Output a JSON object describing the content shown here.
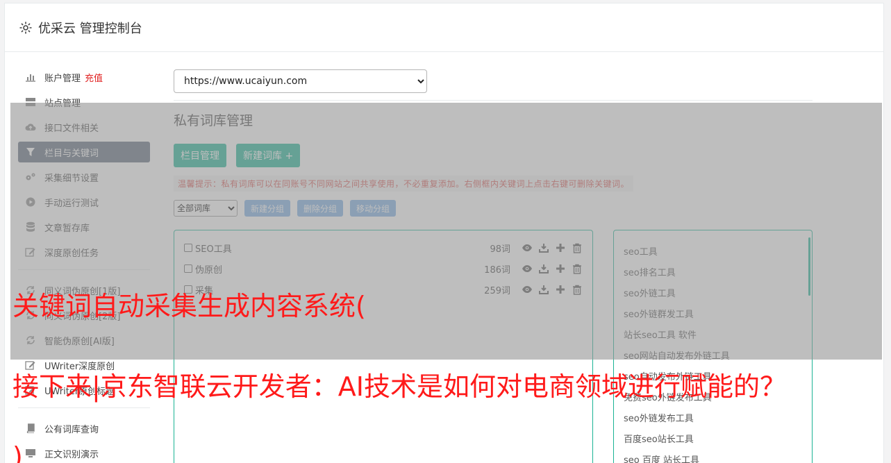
{
  "header": {
    "title": "优采云 管理控制台",
    "icon": "gear-icon"
  },
  "sidebar": {
    "items": [
      {
        "label": "账户管理",
        "extra": "充值",
        "icon": "bar-chart-icon"
      },
      {
        "label": "站点管理",
        "icon": "server-icon"
      },
      {
        "label": "接口文件相关",
        "icon": "cloud-upload-icon"
      },
      {
        "label": "栏目与关键词",
        "icon": "filter-icon",
        "active": true
      },
      {
        "label": "采集细节设置",
        "icon": "gears-icon"
      },
      {
        "label": "手动运行测试",
        "icon": "play-circle-icon"
      },
      {
        "label": "文章暂存库",
        "icon": "database-icon"
      },
      {
        "label": "深度原创任务",
        "icon": "edit-icon"
      },
      {
        "label": "同义词伪原创[1版]",
        "icon": "refresh-icon"
      },
      {
        "label": "同义词伪原创[2版]",
        "icon": "refresh-icon"
      },
      {
        "label": "智能伪原创[AI版]",
        "icon": "refresh-icon"
      },
      {
        "label": "UWriter深度原创",
        "icon": "edit-icon"
      },
      {
        "label": "UWriter原创标题",
        "icon": "edit-icon"
      },
      {
        "label": "公有词库查询",
        "icon": "book-icon"
      },
      {
        "label": "正文识别演示",
        "icon": "monitor-icon"
      }
    ]
  },
  "main": {
    "site_select": "https://www.ucaiyun.com",
    "section_title": "私有词库管理",
    "btn_columns": "栏目管理",
    "btn_new_lib": "新建词库 +",
    "tip": "温馨提示：私有词库可以在同账号不同网站之间共享使用，不必重复添加。右侧框内关键词上点击右键可删除关键词。",
    "filter_select": "全部词库",
    "btn_new_group": "新建分组",
    "btn_delete_group": "删除分组",
    "btn_move_group": "移动分组",
    "libraries": [
      {
        "name": "SEO工具",
        "count": "98词"
      },
      {
        "name": "伪原创",
        "count": "186词"
      },
      {
        "name": "采集",
        "count": "259词"
      }
    ],
    "keywords": [
      "seo工具",
      "seo排名工具",
      "seo外链工具",
      "seo外链群发工具",
      "站长seo工具 软件",
      "seo网站自动发布外链工具",
      "seo自动发布外链工具",
      "免费seo外链发布工具",
      "seo外链发布工具",
      "百度seo站长工具",
      "seo 百度 站长工具"
    ]
  },
  "overlay_text": {
    "line1": "关键词自动采集生成内容系统(",
    "line2": "接下来|京东智联云开发者：AI技术是如何对电商领域进行赋能的？",
    "line3": ")"
  },
  "colors": {
    "accent_green": "#1ab394",
    "active_nav": "#5e6a7c",
    "overlay_text": "#ff1a1a",
    "button_blue": "#7aaee5"
  }
}
